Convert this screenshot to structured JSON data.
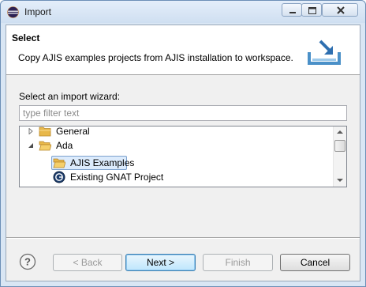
{
  "window": {
    "title": "Import",
    "app_icon": "eclipse-icon",
    "controls": {
      "minimize": "minimize-icon",
      "maximize": "maximize-icon",
      "close": "close-icon"
    }
  },
  "banner": {
    "title": "Select",
    "description": "Copy AJIS examples projects from AJIS installation to workspace.",
    "icon": "import-tray-icon"
  },
  "wizard": {
    "label": "Select an import wizard:",
    "filter_placeholder": "type filter text",
    "tree": {
      "general": {
        "label": "General",
        "expanded": false
      },
      "ada": {
        "label": "Ada",
        "expanded": true
      },
      "ajis_examples": {
        "label": "AJIS Examples",
        "selected": true
      },
      "gnat_project": {
        "label": "Existing GNAT Project"
      }
    }
  },
  "buttons": {
    "back": "< Back",
    "next": "Next >",
    "finish": "Finish",
    "cancel": "Cancel"
  },
  "colors": {
    "selection_fill": "#dcebfc",
    "selection_border": "#7da2ce",
    "folder": "#e8b84a"
  }
}
